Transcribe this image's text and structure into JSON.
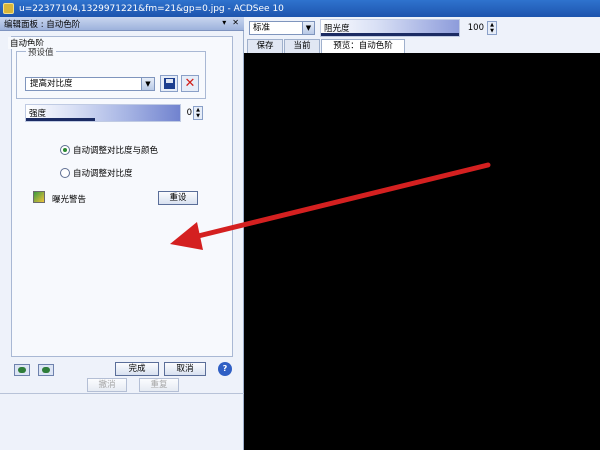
{
  "window": {
    "title": "u=22377104,1329971221&fm=21&gp=0.jpg - ACDSee 10"
  },
  "left_panel": {
    "header": "编辑面板 : 自动色阶",
    "pin_glyph": "▾",
    "close_glyph": "✕",
    "group_label": "自动色阶",
    "preset": {
      "label": "预设值",
      "value": "提高对比度"
    },
    "strength": {
      "label": "强度",
      "value": "0"
    },
    "radio_options": [
      {
        "label": "自动调整对比度与颜色",
        "checked": true
      },
      {
        "label": "自动调整对比度",
        "checked": false
      }
    ],
    "exposure_warning_label": "曝光警告",
    "reset_label": "重设",
    "done_label": "完成",
    "cancel_label": "取消",
    "undo_label": "撤消",
    "redo_label": "重复",
    "help_label": "?"
  },
  "right_area": {
    "mode": "标准",
    "opacity": {
      "label": "阻光度",
      "value": "100"
    },
    "tabs": [
      {
        "label": "保存",
        "active": false
      },
      {
        "label": "当前",
        "active": false
      },
      {
        "label": "预览：自动色阶",
        "active": true
      }
    ]
  },
  "colors": {
    "annotation_arrow": "#d42020",
    "preview_background": "#000000",
    "title_bar": "#1d54ad"
  },
  "icons": [
    "app-icon",
    "floppy-save-icon",
    "delete-x-icon",
    "dropdown-arrow-icon",
    "exposure-warning-icon",
    "help-icon",
    "nav-back-icon",
    "nav-forward-icon"
  ]
}
